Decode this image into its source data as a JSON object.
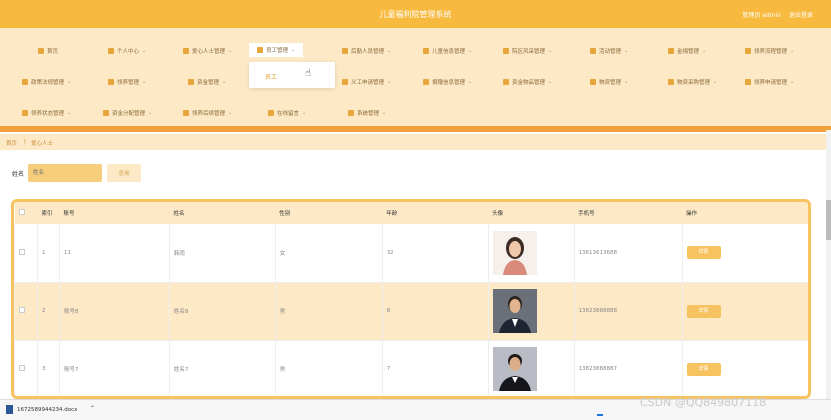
{
  "app": {
    "title": "儿童福利院管理系统",
    "user_label": "管理员 admin",
    "logout": "退出登录"
  },
  "nav": {
    "row1": [
      "首页",
      "个人中心",
      "爱心人士管理",
      "员工管理",
      "后勤人员管理",
      "儿童信息管理",
      "院区风采管理",
      "活动管理",
      "金捐管理",
      "领养流程管理"
    ],
    "row2": [
      "政策法规管理",
      "领养管理",
      "资金管理",
      "",
      "义工申请管理",
      "捐赠信息管理",
      "资金物品管理",
      "物资管理",
      "物资采购管理",
      "领养申请管理"
    ],
    "row3": [
      "领养状态管理",
      "资金分配管理",
      "领养后续管理",
      "在线留言",
      "系统管理"
    ],
    "dropdown_option": "员工"
  },
  "breadcrumb": {
    "home": "首页",
    "sep": "|",
    "current": "爱心人士"
  },
  "search": {
    "label": "姓名",
    "placeholder": "姓名",
    "button": "查询"
  },
  "table": {
    "headers": [
      "",
      "索引",
      "账号",
      "姓名",
      "性别",
      "年龄",
      "头像",
      "手机号",
      "操作"
    ],
    "rows": [
      {
        "index": "1",
        "account": "11",
        "name": "韩雨",
        "gender": "女",
        "age": "32",
        "phone": "13613613688",
        "action": "详情"
      },
      {
        "index": "2",
        "account": "账号8",
        "name": "姓名8",
        "gender": "男",
        "age": "8",
        "phone": "13823888888",
        "action": "详情"
      },
      {
        "index": "3",
        "account": "账号7",
        "name": "姓名7",
        "gender": "男",
        "age": "7",
        "phone": "13823888887",
        "action": "详情"
      }
    ]
  },
  "download": {
    "filename": "1672589944234.docx"
  },
  "watermark": "CSDN @QQ849807118"
}
